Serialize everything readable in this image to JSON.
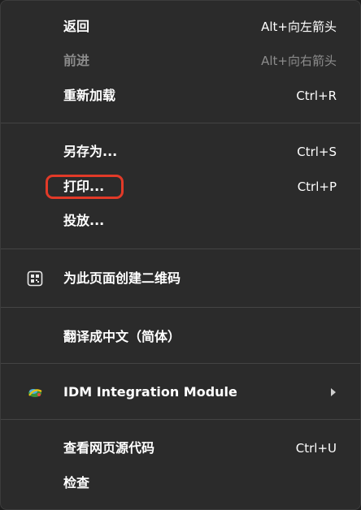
{
  "menu": {
    "items": [
      {
        "label": "返回",
        "shortcut": "Alt+向左箭头"
      },
      {
        "label": "前进",
        "shortcut": "Alt+向右箭头"
      },
      {
        "label": "重新加载",
        "shortcut": "Ctrl+R"
      },
      {
        "label": "另存为...",
        "shortcut": "Ctrl+S"
      },
      {
        "label": "打印...",
        "shortcut": "Ctrl+P"
      },
      {
        "label": "投放..."
      },
      {
        "label": "为此页面创建二维码"
      },
      {
        "label": "翻译成中文（简体）"
      },
      {
        "label": "IDM Integration Module"
      },
      {
        "label": "查看网页源代码",
        "shortcut": "Ctrl+U"
      },
      {
        "label": "检查"
      }
    ],
    "disabled_item": "前进",
    "highlighted_item": "打印...",
    "highlight_color": "#e23a28"
  }
}
